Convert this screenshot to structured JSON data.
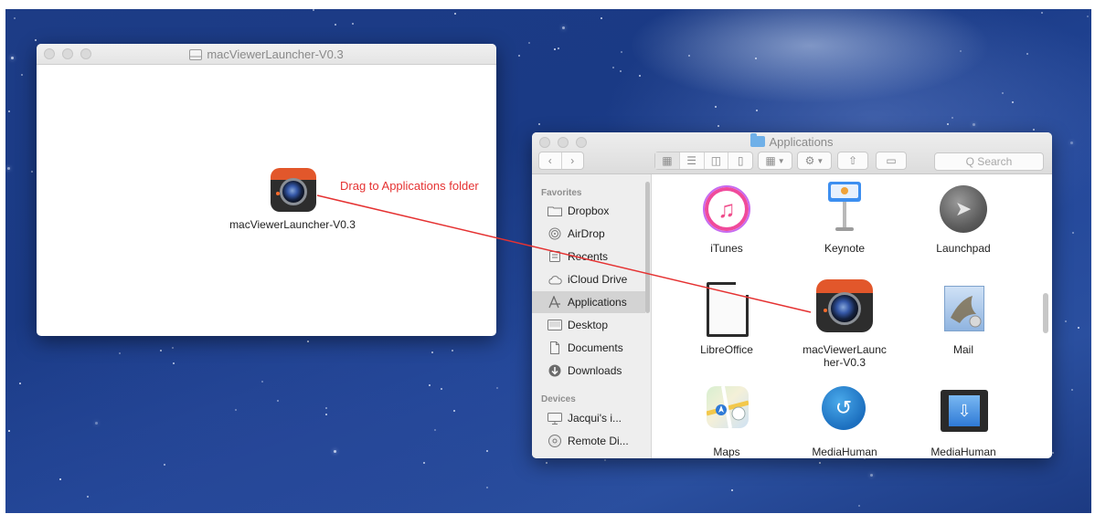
{
  "desktop": {
    "dmg_window": {
      "title": "macViewerLauncher-V0.3",
      "app_icon_label": "macViewerLauncher-V0.3",
      "instruction": "Drag to Applications folder"
    },
    "finder_window": {
      "title": "Applications",
      "search_placeholder": "Q Search",
      "sidebar": {
        "favorites_header": "Favorites",
        "favorites": [
          {
            "label": "Dropbox",
            "icon": "folder-icon"
          },
          {
            "label": "AirDrop",
            "icon": "airdrop-icon"
          },
          {
            "label": "Recents",
            "icon": "recents-icon"
          },
          {
            "label": "iCloud Drive",
            "icon": "cloud-icon"
          },
          {
            "label": "Applications",
            "icon": "applications-icon"
          },
          {
            "label": "Desktop",
            "icon": "desktop-icon"
          },
          {
            "label": "Documents",
            "icon": "documents-icon"
          },
          {
            "label": "Downloads",
            "icon": "downloads-icon"
          }
        ],
        "devices_header": "Devices",
        "devices": [
          {
            "label": "Jacqui's i...",
            "icon": "computer-icon"
          },
          {
            "label": "Remote Di...",
            "icon": "disc-icon"
          }
        ],
        "selected": "Applications"
      },
      "apps": [
        {
          "label": "iTunes",
          "icon": "itunes-icon"
        },
        {
          "label": "Keynote",
          "icon": "keynote-icon"
        },
        {
          "label": "Launchpad",
          "icon": "launchpad-icon"
        },
        {
          "label": "LibreOffice",
          "icon": "libreoffice-icon"
        },
        {
          "label": "macViewerLaunc",
          "label2": "her-V0.3",
          "icon": "camera-app-icon"
        },
        {
          "label": "Mail",
          "icon": "mail-icon"
        },
        {
          "label": "Maps",
          "icon": "maps-icon"
        },
        {
          "label": "MediaHuman",
          "icon": "mediahuman-icon"
        },
        {
          "label": "MediaHuman",
          "icon": "mediahuman-video-icon"
        }
      ]
    },
    "colors": {
      "arrow": "#e53232",
      "camera_accent": "#e2572b"
    }
  }
}
